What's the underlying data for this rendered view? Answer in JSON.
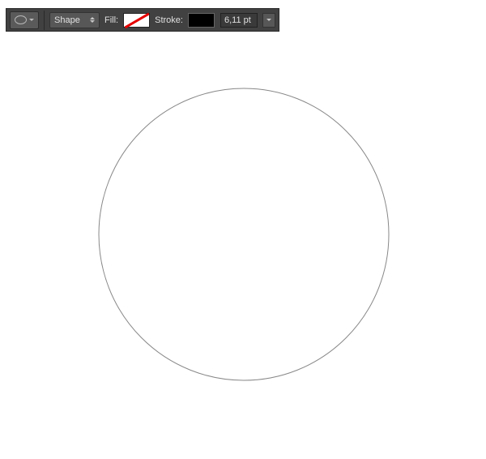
{
  "toolbar": {
    "mode_label": "Shape",
    "fill_label": "Fill:",
    "stroke_label": "Stroke:",
    "stroke_value": "6,11 pt",
    "fill_color": "none",
    "stroke_color": "#000000"
  }
}
